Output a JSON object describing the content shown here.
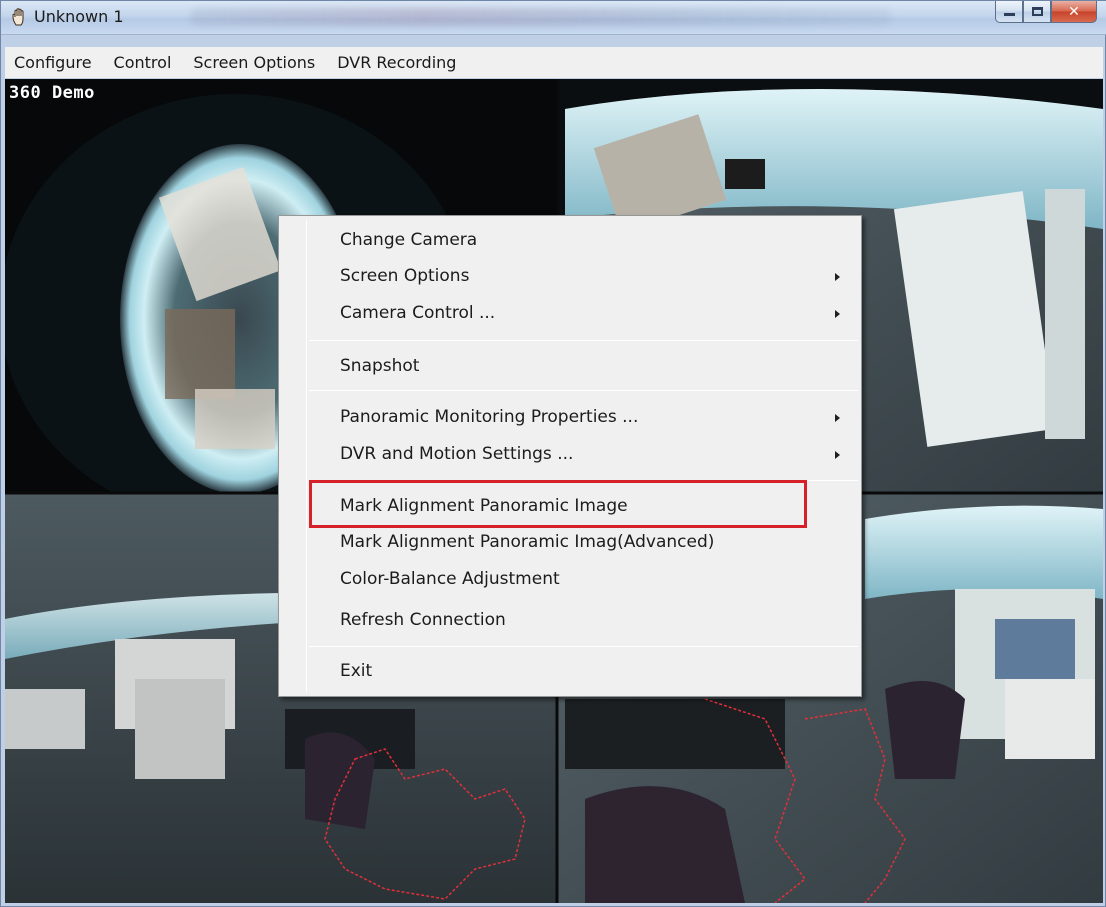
{
  "window": {
    "title": "Unknown 1",
    "caption_buttons": [
      "minimize",
      "maximize",
      "close"
    ]
  },
  "menubar": {
    "items": [
      "Configure",
      "Control",
      "Screen Options",
      "DVR Recording"
    ]
  },
  "video": {
    "title": "360 Demo"
  },
  "context_menu": {
    "items": [
      {
        "label": "Change Camera",
        "submenu": false
      },
      {
        "label": "Screen Options",
        "submenu": true
      },
      {
        "label": "Camera Control ...",
        "submenu": true
      },
      {
        "label": "Snapshot",
        "submenu": false
      },
      {
        "label": "Panoramic Monitoring Properties ...",
        "submenu": true
      },
      {
        "label": "DVR and Motion Settings ...",
        "submenu": true
      },
      {
        "label": "Mark Alignment Panoramic Image",
        "submenu": false,
        "highlighted": true
      },
      {
        "label": "Mark Alignment Panoramic Imag(Advanced)",
        "submenu": false
      },
      {
        "label": "Color-Balance Adjustment",
        "submenu": false
      },
      {
        "label": "Refresh Connection",
        "submenu": false
      },
      {
        "label": "Exit",
        "submenu": false
      }
    ]
  },
  "colors": {
    "highlight_box": "#d6202a",
    "motion_outline": "#e0303a"
  }
}
